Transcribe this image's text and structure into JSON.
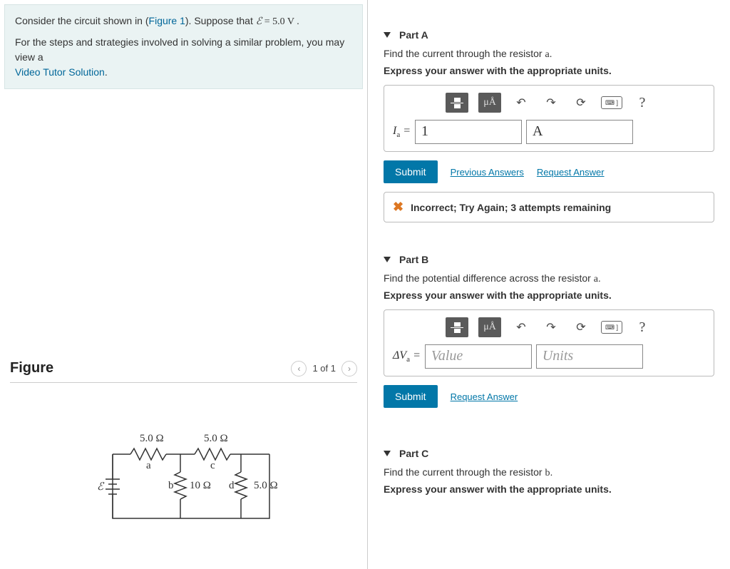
{
  "problem": {
    "text_before": "Consider the circuit shown in (",
    "figure_link": "Figure 1",
    "text_after": "). Suppose that ",
    "emf_symbol": "ℰ",
    "emf_value": " = 5.0  V .",
    "steps_text": "For the steps and strategies involved in solving a similar problem, you may view a ",
    "video_link": "Video Tutor Solution",
    "period": "."
  },
  "figure": {
    "title": "Figure",
    "pager": "1 of 1"
  },
  "circuit": {
    "r_a": "5.0 Ω",
    "r_c": "5.0 Ω",
    "r_b": "10 Ω",
    "r_d": "5.0 Ω",
    "emf": "ℰ",
    "node_a": "a",
    "node_b": "b",
    "node_c": "c",
    "node_d": "d"
  },
  "parts": {
    "a": {
      "title": "Part A",
      "prompt_before": "Find the current through the resistor ",
      "prompt_var": "a",
      "prompt_after": ".",
      "instruct": "Express your answer with the appropriate units.",
      "label": "I",
      "sub": "a",
      "eq": " = ",
      "value": "1",
      "unit": "A",
      "submit": "Submit",
      "prev_link": "Previous Answers",
      "req_link": "Request Answer",
      "feedback": "Incorrect; Try Again; 3 attempts remaining"
    },
    "b": {
      "title": "Part B",
      "prompt_before": "Find the potential difference across the resistor ",
      "prompt_var": "a",
      "prompt_after": ".",
      "instruct": "Express your answer with the appropriate units.",
      "label": "ΔV",
      "sub": "a",
      "eq": " = ",
      "value_ph": "Value",
      "unit_ph": "Units",
      "submit": "Submit",
      "req_link": "Request Answer"
    },
    "c": {
      "title": "Part C",
      "prompt_before": "Find the current through the resistor ",
      "prompt_var": "b",
      "prompt_after": ".",
      "instruct": "Express your answer with the appropriate units."
    }
  },
  "toolbar": {
    "unit_btn": "μÅ",
    "undo": "↶",
    "redo": "↷",
    "reset": "⟳",
    "keyboard": "⌨ ]",
    "help": "?"
  }
}
